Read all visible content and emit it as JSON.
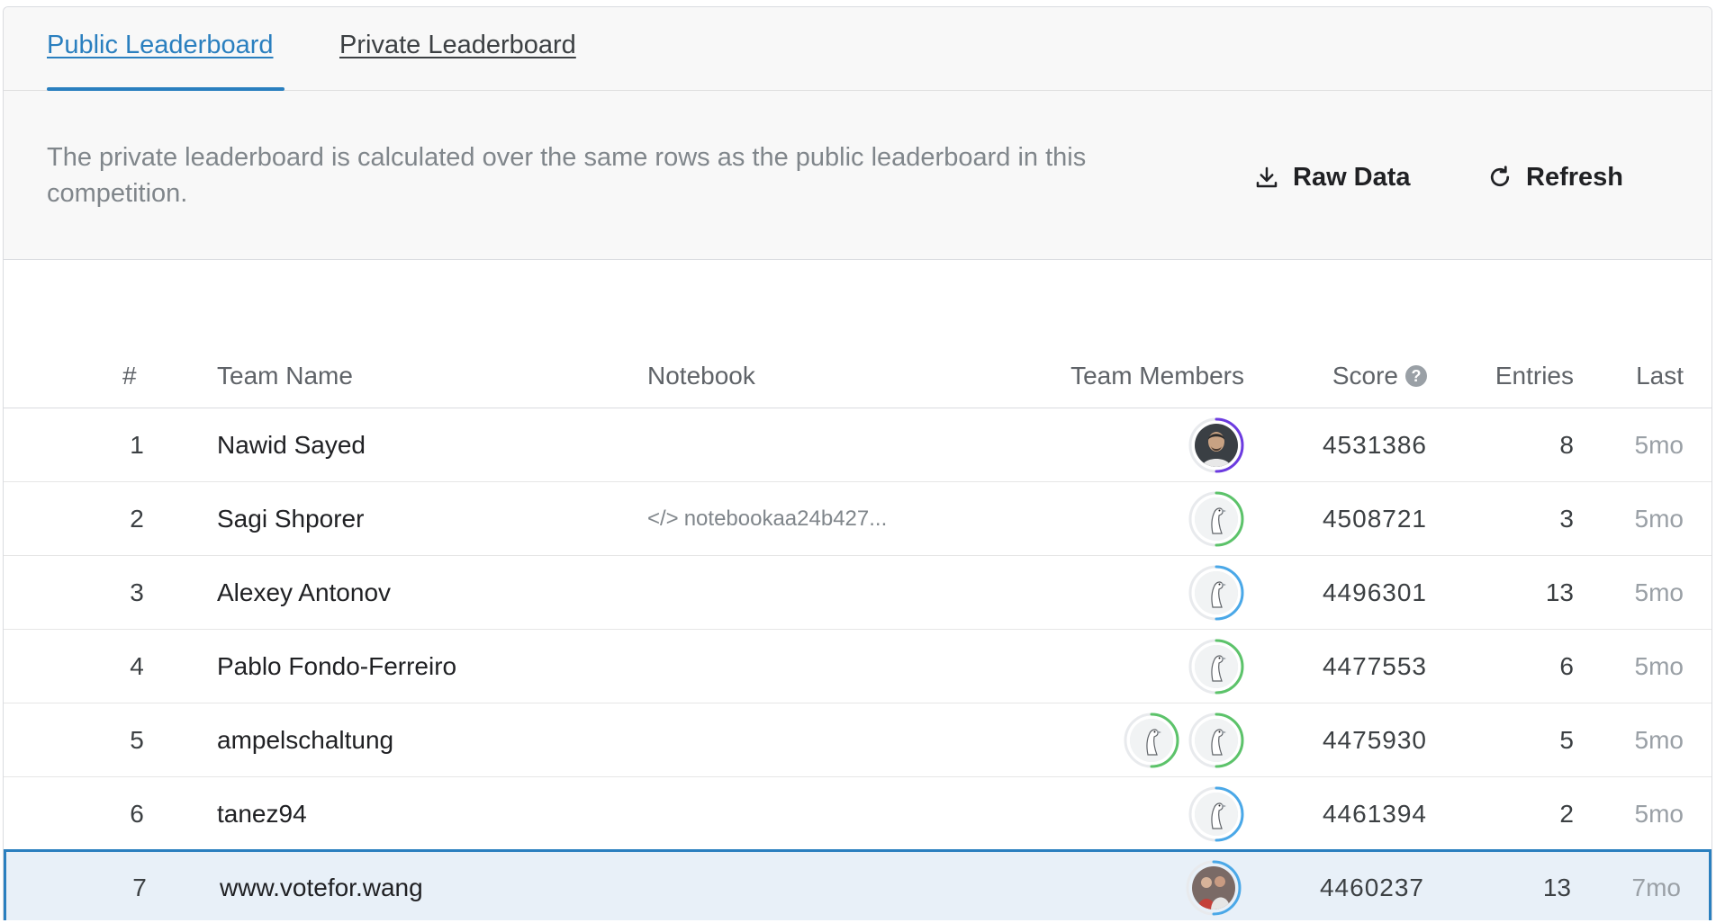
{
  "tabs": [
    {
      "label": "Public Leaderboard",
      "active": true
    },
    {
      "label": "Private Leaderboard",
      "active": false
    }
  ],
  "info": {
    "text": "The private leaderboard is calculated over the same rows as the public leaderboard in this competition."
  },
  "actions": {
    "raw_data": "Raw Data",
    "refresh": "Refresh"
  },
  "table": {
    "headers": {
      "rank": "#",
      "team": "Team Name",
      "notebook": "Notebook",
      "members": "Team Members",
      "score": "Score",
      "entries": "Entries",
      "last": "Last"
    },
    "rows": [
      {
        "rank": "1",
        "team": "Nawid Sayed",
        "notebook": "",
        "score": "4531386",
        "entries": "8",
        "last": "5mo",
        "members": [
          {
            "tier_color": "#6c3be0",
            "avatar": "photo-dark"
          }
        ]
      },
      {
        "rank": "2",
        "team": "Sagi Shporer",
        "notebook": "notebookaa24b427...",
        "score": "4508721",
        "entries": "3",
        "last": "5mo",
        "members": [
          {
            "tier_color": "#5cc36a",
            "avatar": "default-goose"
          }
        ]
      },
      {
        "rank": "3",
        "team": "Alexey Antonov",
        "notebook": "",
        "score": "4496301",
        "entries": "13",
        "last": "5mo",
        "members": [
          {
            "tier_color": "#4aa8e8",
            "avatar": "default-goose"
          }
        ]
      },
      {
        "rank": "4",
        "team": "Pablo Fondo-Ferreiro",
        "notebook": "",
        "score": "4477553",
        "entries": "6",
        "last": "5mo",
        "members": [
          {
            "tier_color": "#5cc36a",
            "avatar": "default-goose"
          }
        ]
      },
      {
        "rank": "5",
        "team": "ampelschaltung",
        "notebook": "",
        "score": "4475930",
        "entries": "5",
        "last": "5mo",
        "members": [
          {
            "tier_color": "#5cc36a",
            "avatar": "default-goose"
          },
          {
            "tier_color": "#5cc36a",
            "avatar": "default-goose"
          }
        ]
      },
      {
        "rank": "6",
        "team": "tanez94",
        "notebook": "",
        "score": "4461394",
        "entries": "2",
        "last": "5mo",
        "members": [
          {
            "tier_color": "#4aa8e8",
            "avatar": "default-goose"
          }
        ]
      },
      {
        "rank": "7",
        "team": "www.votefor.wang",
        "notebook": "",
        "score": "4460237",
        "entries": "13",
        "last": "7mo",
        "highlight": true,
        "members": [
          {
            "tier_color": "#4aa8e8",
            "avatar": "photo-group"
          }
        ]
      }
    ]
  },
  "colors": {
    "accent": "#2a7fbf",
    "highlight_bg": "#e8f0f8"
  }
}
